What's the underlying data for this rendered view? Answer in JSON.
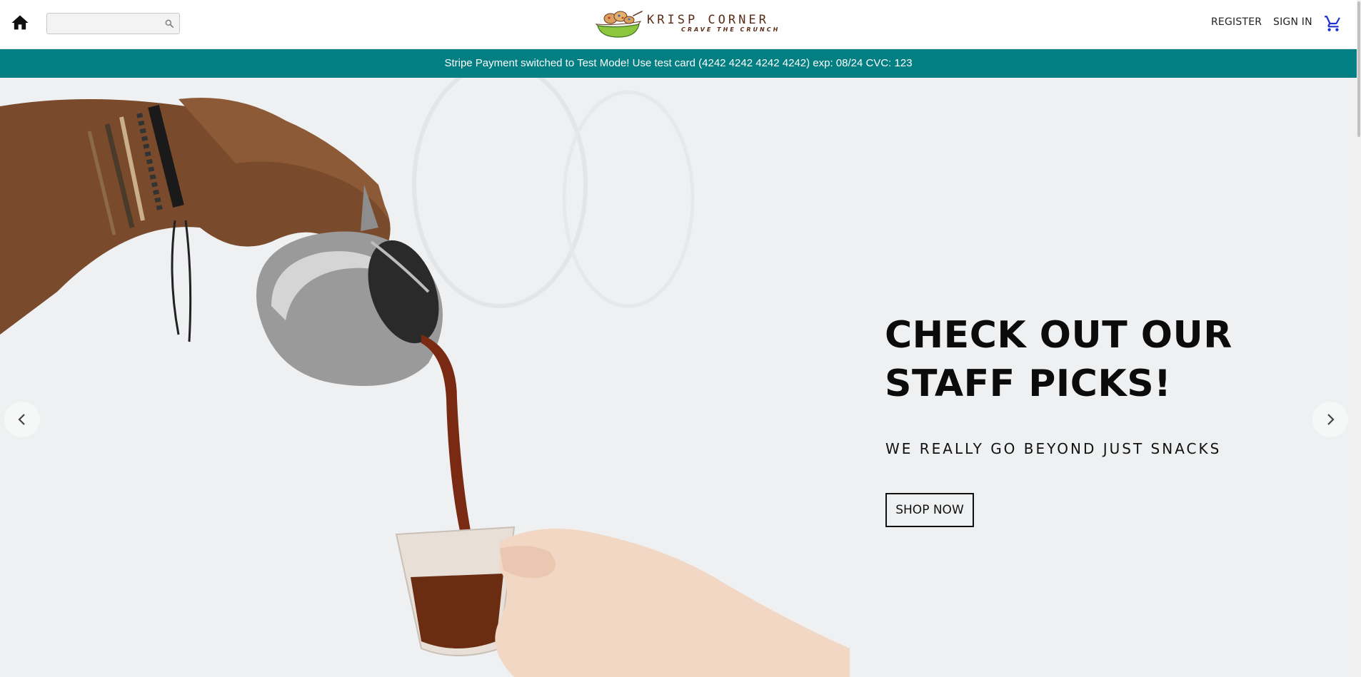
{
  "header": {
    "home_icon": "home-icon",
    "search": {
      "value": "",
      "placeholder": "",
      "icon": "search-icon"
    },
    "logo": {
      "name": "KRISP CORNER",
      "tagline": "CRAVE THE CRUNCH"
    },
    "nav": {
      "register_label": "REGISTER",
      "signin_label": "SIGN IN",
      "cart_icon": "cart-icon"
    }
  },
  "banner": {
    "text": "Stripe Payment switched to Test Mode! Use test card (4242 4242 4242 4242) exp: 08/24 CVC: 123"
  },
  "hero": {
    "title": "CHECK OUT OUR STAFF PICKS!",
    "subtitle": "WE REALLY GO BEYOND JUST SNACKS",
    "cta_label": "SHOP NOW",
    "prev_icon": "chevron-left-icon",
    "next_icon": "chevron-right-icon"
  },
  "colors": {
    "banner_bg": "#017f82",
    "hero_bg": "#eff0f1",
    "logo_brown": "#5b2b17",
    "cart_blue": "#1f2fd1",
    "logo_bowl_green": "#8cc63f"
  }
}
